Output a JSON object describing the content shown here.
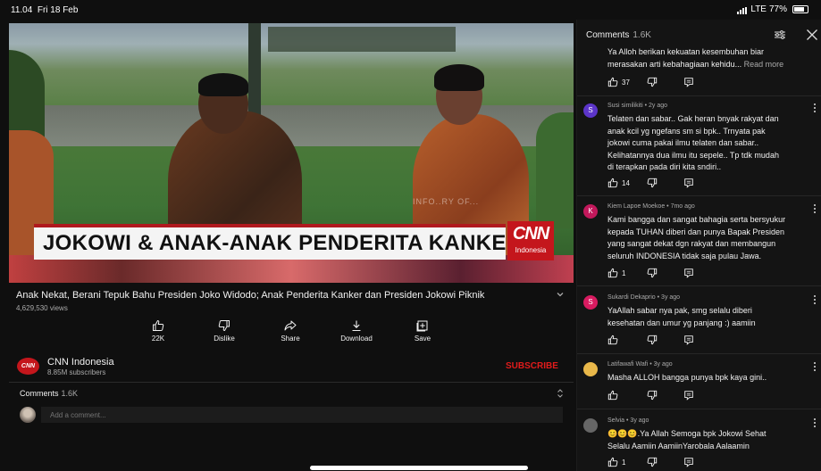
{
  "status_bar": {
    "time": "11.04",
    "date": "Fri 18 Feb",
    "network": "LTE",
    "battery": "77%",
    "battery_level": 0.77
  },
  "video": {
    "caption": "JOKOWI & ANAK-ANAK PENDERITA KANKER",
    "logo": "CNN",
    "logo_sub": "Indonesia",
    "watermark": "INFO..RY OF..."
  },
  "title": "Anak Nekat, Berani Tepuk Bahu Presiden Joko Widodo; Anak Penderita Kanker dan Presiden Jokowi Piknik",
  "views": "4,629,530 views",
  "actions": [
    {
      "label": "22K",
      "icon": "thumbs-up-icon"
    },
    {
      "label": "Dislike",
      "icon": "thumbs-down-icon"
    },
    {
      "label": "Share",
      "icon": "share-icon"
    },
    {
      "label": "Download",
      "icon": "download-icon"
    },
    {
      "label": "Save",
      "icon": "save-icon"
    }
  ],
  "channel": {
    "name": "CNN Indonesia",
    "subscribers": "8.85M subscribers",
    "avatar_text": "CNN",
    "subscribe_label": "SUBSCRIBE"
  },
  "comments_section": {
    "label": "Comments",
    "count": "1.6K",
    "placeholder": "Add a comment..."
  },
  "panel": {
    "title": "Comments",
    "count": "1.6K",
    "comments": [
      {
        "author": "",
        "time": "",
        "avatar_letter": "",
        "avatar_color": "",
        "text_lines": [
          "Ya Alloh berikan kekuatan kesembuhan biar",
          "merasakan arti kebahagiaan kehidu..."
        ],
        "read_more": "Read more",
        "likes": "37"
      },
      {
        "author": "Susi similikiti",
        "time": "2y ago",
        "avatar_letter": "S",
        "avatar_color": "#5c35c9",
        "text_lines": [
          "Telaten dan sabar.. Gak heran bnyak rakyat dan",
          "anak kcil yg ngefans sm si bpk.. Trnyata pak",
          "jokowi cuma pakai ilmu telaten dan sabar..",
          "Kelihatannya dua ilmu itu sepele.. Tp tdk mudah",
          "di terapkan pada diri kita sndiri.."
        ],
        "likes": "14"
      },
      {
        "author": "Kiem Lapoe Moekoe",
        "time": "7mo ago",
        "avatar_letter": "K",
        "avatar_color": "#c2185b",
        "text_lines": [
          "Kami bangga dan sangat bahagia serta bersyukur",
          "kepada TUHAN diberi dan punya Bapak Presiden",
          "yang sangat dekat dgn rakyat dan membangun",
          "seluruh INDONESIA tidak saja pulau Jawa."
        ],
        "likes": "1"
      },
      {
        "author": "Sukardi Dekaprio",
        "time": "3y ago",
        "avatar_letter": "S",
        "avatar_color": "#d81b60",
        "text_lines": [
          "YaAllah sabar nya pak, smg selalu diberi",
          "kesehatan dan umur yg panjang :) aamiin"
        ],
        "likes": ""
      },
      {
        "author": "Latifawafi Wafi",
        "time": "3y ago",
        "avatar_letter": "",
        "avatar_color": "#e9b84a",
        "text_lines": [
          "Masha ALLOH bangga punya bpk kaya gini.."
        ],
        "likes": ""
      },
      {
        "author": "Selvia",
        "time": "3y ago",
        "avatar_letter": "",
        "avatar_color": "#666",
        "text_lines": [
          "😊😊😊.Ya Allah Semoga bpk Jokowi Sehat",
          "Selalu Aamiin AamiinYarobala Aalaamin"
        ],
        "likes": "1"
      }
    ]
  },
  "colors": {
    "background": "#0f0f0f",
    "panel": "#141414",
    "subscribe": "#e01b1b",
    "cnn_red": "#c4161c"
  }
}
